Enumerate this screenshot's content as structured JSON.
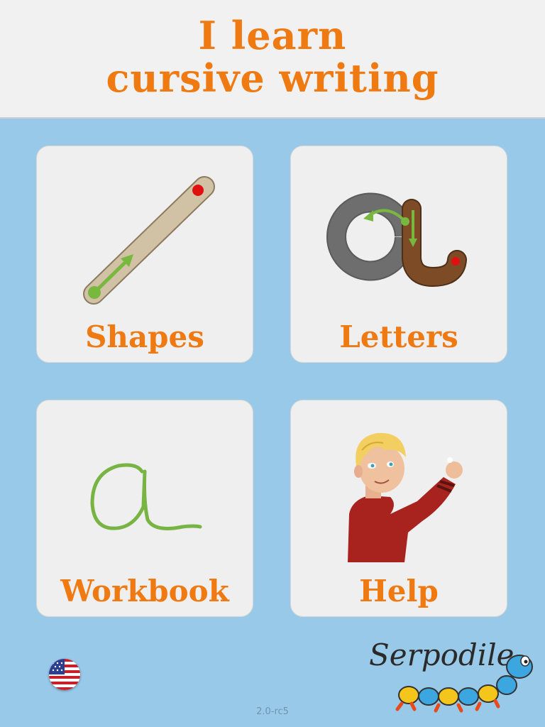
{
  "header": {
    "title_line1": "I learn",
    "title_line2": "cursive writing"
  },
  "tiles": [
    {
      "label": "Shapes",
      "icon": "shape-tracing-icon"
    },
    {
      "label": "Letters",
      "icon": "letter-tracing-icon"
    },
    {
      "label": "Workbook",
      "icon": "workbook-icon"
    },
    {
      "label": "Help",
      "icon": "help-boy-illustration"
    }
  ],
  "language": {
    "icon": "us-flag-icon"
  },
  "footer": {
    "version": "2.0-rc5"
  },
  "brand": {
    "name": "Serpodile"
  },
  "colors": {
    "accent": "#f07a12",
    "background": "#98c9e8",
    "tile": "#efefef"
  }
}
